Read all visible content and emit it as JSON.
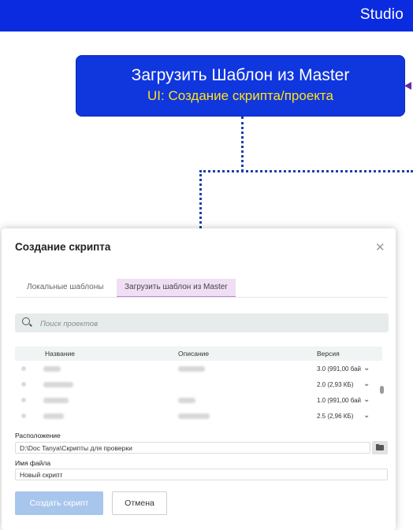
{
  "header": {
    "title": "Studio"
  },
  "slide": {
    "title": "Загрузить Шаблон из Master",
    "subtitle": "UI: Создание скрипта/проекта"
  },
  "dialog": {
    "title": "Создание скрипта",
    "close_icon": "close-icon",
    "tabs": [
      {
        "label": "Локальные шаблоны",
        "active": false
      },
      {
        "label": "Загрузить шаблон из Master",
        "active": true
      }
    ],
    "search": {
      "placeholder": "Поиск проектов",
      "icon": "search-icon"
    },
    "table": {
      "columns": [
        "Название",
        "Описание",
        "Версия"
      ],
      "rows": [
        {
          "version": "3.0 (991,00 бай"
        },
        {
          "version": "2.0 (2,93 КБ)"
        },
        {
          "version": "1.0 (991,00 бай"
        },
        {
          "version": "2.5 (2,96 КБ)"
        }
      ]
    },
    "location": {
      "label": "Расположение",
      "value": "D:\\Doc Tanya\\Скрипты для проверки",
      "folder_icon": "folder-icon"
    },
    "filename": {
      "label": "Имя файла",
      "value": "Новый скрипт"
    },
    "buttons": {
      "create": "Создать скрипт",
      "cancel": "Отмена"
    }
  },
  "colors": {
    "topbar": "#0a2be0",
    "slide_box": "#1036de",
    "slide_subtitle": "#ffe21a",
    "active_tab": "#f0dff4",
    "primary_button_disabled": "#a8c6ec"
  }
}
